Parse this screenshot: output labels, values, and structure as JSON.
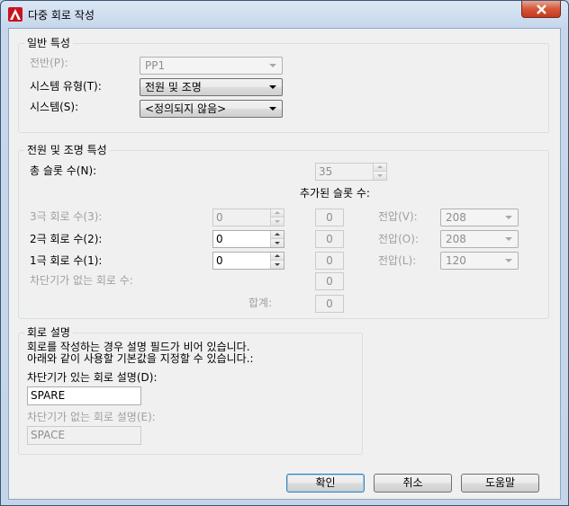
{
  "window": {
    "title": "다중 회로 작성"
  },
  "general": {
    "title": "일반 특성",
    "panel_label": "전반(P):",
    "panel_value": "PP1",
    "system_type_label": "시스템 유형(T):",
    "system_type_value": "전원 및 조명",
    "system_label": "시스템(S):",
    "system_value": "<정의되지 않음>"
  },
  "power": {
    "title": "전원 및 조명 특성",
    "total_slots_label": "총 슬롯 수(N):",
    "total_slots_value": "35",
    "added_slots_label": "추가된 슬롯 수:",
    "rows": [
      {
        "label": "3극 회로 수(3):",
        "value": "0",
        "added": "0",
        "voltage_label": "전압(V):",
        "voltage_value": "208"
      },
      {
        "label": "2극 회로 수(2):",
        "value": "0",
        "added": "0",
        "voltage_label": "전압(O):",
        "voltage_value": "208"
      },
      {
        "label": "1극 회로 수(1):",
        "value": "0",
        "added": "0",
        "voltage_label": "전압(L):",
        "voltage_value": "120"
      }
    ],
    "no_breaker_label": "차단기가 없는 회로 수:",
    "no_breaker_added": "0",
    "total_label": "합계:",
    "total_value": "0"
  },
  "description": {
    "title": "회로 설명",
    "info_line1": "회로를 작성하는 경우 설명 필드가 비어 있습니다.",
    "info_line2": "아래와 같이 사용할 기본값을 지정할 수 있습니다.:",
    "with_breaker_label": "차단기가 있는 회로 설명(D):",
    "with_breaker_value": "SPARE",
    "without_breaker_label": "차단기가 없는 회로 설명(E):",
    "without_breaker_value": "SPACE"
  },
  "buttons": {
    "ok": "확인",
    "cancel": "취소",
    "help": "도움말"
  }
}
